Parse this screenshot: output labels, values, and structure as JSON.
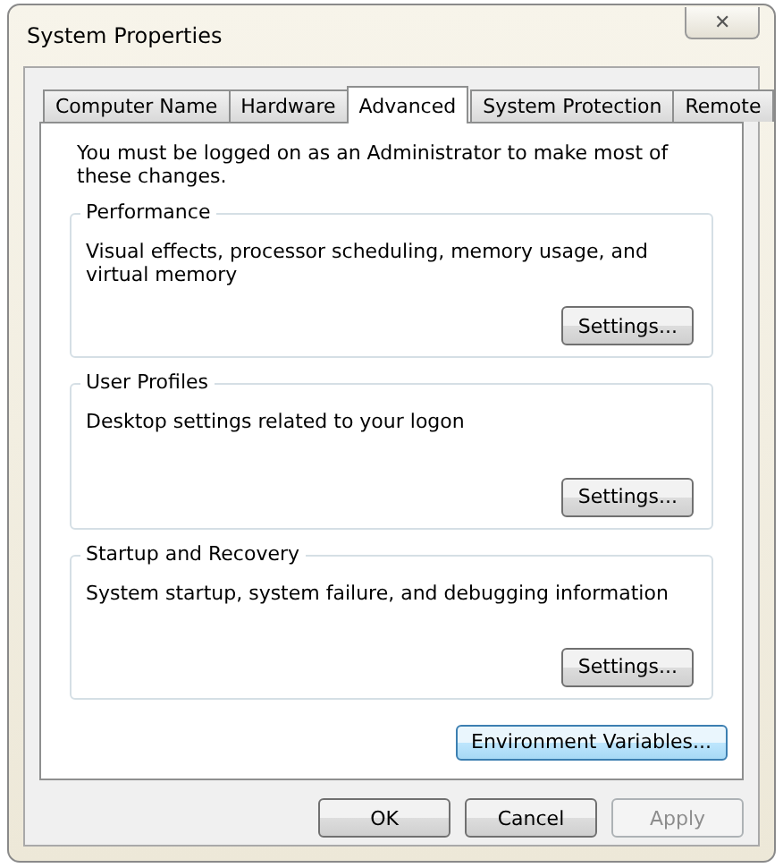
{
  "window": {
    "title": "System Properties",
    "close": "✕"
  },
  "tabs": [
    {
      "label": "Computer Name",
      "selected": false
    },
    {
      "label": "Hardware",
      "selected": false
    },
    {
      "label": "Advanced",
      "selected": true
    },
    {
      "label": "System Protection",
      "selected": false
    },
    {
      "label": "Remote",
      "selected": false
    }
  ],
  "notice": "You must be logged on as an Administrator to make most of these changes.",
  "groups": [
    {
      "title": "Performance",
      "description": "Visual effects, processor scheduling, memory usage, and virtual memory",
      "button": "Settings..."
    },
    {
      "title": "User Profiles",
      "description": "Desktop settings related to your logon",
      "button": "Settings..."
    },
    {
      "title": "Startup and Recovery",
      "description": "System startup, system failure, and debugging information",
      "button": "Settings..."
    }
  ],
  "environment_button": {
    "label": "Environment Variables...",
    "focused": true
  },
  "buttons": [
    {
      "label": "OK",
      "disabled": false
    },
    {
      "label": "Cancel",
      "disabled": false
    },
    {
      "label": "Apply",
      "disabled": true
    }
  ]
}
